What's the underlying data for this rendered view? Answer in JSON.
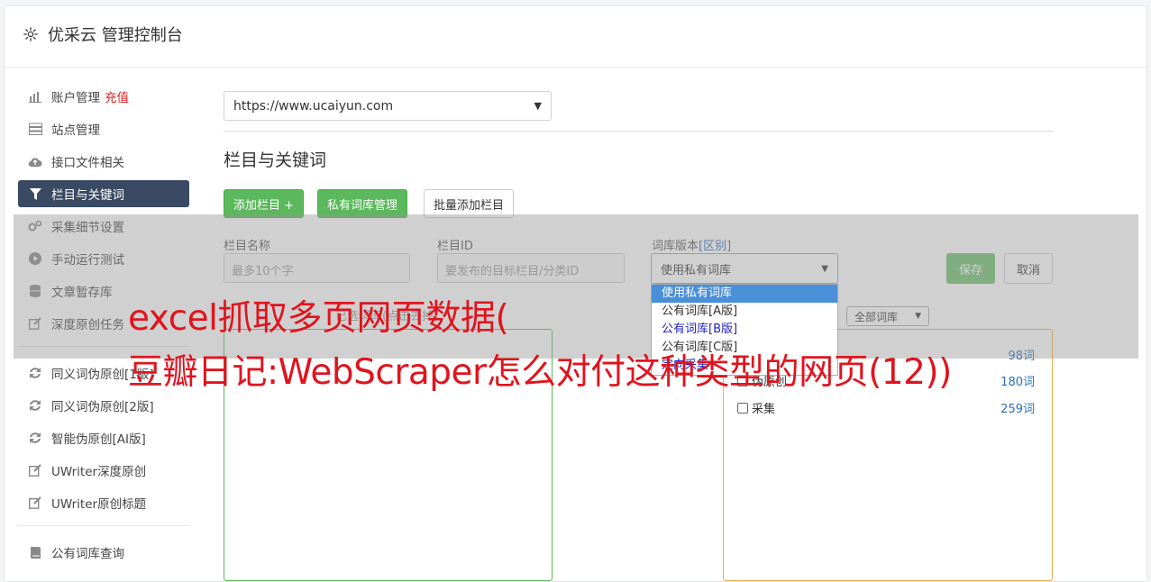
{
  "header": {
    "title": "优采云 管理控制台",
    "icon": "gear-icon"
  },
  "nav": {
    "items": [
      {
        "label": "账户管理",
        "icon": "bar-chart-icon",
        "extra": "充值"
      },
      {
        "label": "站点管理",
        "icon": "server-icon"
      },
      {
        "label": "接口文件相关",
        "icon": "cloud-upload-icon"
      },
      {
        "label": "栏目与关键词",
        "icon": "filter-icon",
        "active": true
      },
      {
        "label": "采集细节设置",
        "icon": "gears-icon"
      },
      {
        "label": "手动运行测试",
        "icon": "play-circle-icon"
      },
      {
        "label": "文章暂存库",
        "icon": "database-icon"
      },
      {
        "label": "深度原创任务",
        "icon": "edit-icon"
      }
    ],
    "items2": [
      {
        "label": "同义词伪原创[1版]",
        "icon": "refresh-icon"
      },
      {
        "label": "同义词伪原创[2版]",
        "icon": "refresh-icon"
      },
      {
        "label": "智能伪原创[AI版]",
        "icon": "refresh-icon"
      },
      {
        "label": "UWriter深度原创",
        "icon": "edit-icon"
      },
      {
        "label": "UWriter原创标题",
        "icon": "edit-icon"
      }
    ],
    "items3": [
      {
        "label": "公有词库查询",
        "icon": "book-icon"
      }
    ]
  },
  "main": {
    "site_select": "https://www.ucaiyun.com",
    "section_title": "栏目与关键词",
    "buttons": {
      "add_column": "添加栏目 +",
      "private_lib": "私有词库管理",
      "batch_add": "批量添加栏目"
    },
    "form": {
      "name_label": "栏目名称",
      "name_placeholder": "最多10个字",
      "id_label": "栏目ID",
      "id_placeholder": "要发布的目标栏目/分类ID",
      "lib_label": "词库版本",
      "lib_label_link": "[区别]",
      "lib_value": "使用私有词库",
      "save": "保存",
      "cancel": "取消"
    },
    "dropdown_options": [
      "使用私有词库",
      "公有词库[A版]",
      "公有词库[B版]",
      "公有词库[C版]",
      "定向采集"
    ],
    "left_box_header": "已选词库(点击去掉)",
    "lib_filter": "全部词库",
    "lib_rows": [
      {
        "label": "",
        "count": "98词"
      },
      {
        "label": "伪原创",
        "count": "180词"
      },
      {
        "label": "采集",
        "count": "259词"
      }
    ]
  },
  "watermark": {
    "line1": "excel抓取多页网页数据(",
    "line2": "豆瓣日记:WebScraper怎么对付这种类型的网页(12))"
  },
  "colors": {
    "accent_green": "#5cb85c",
    "active_nav": "#3b4a63",
    "watermark": "#e0141e",
    "select_blue": "#4a90d9"
  }
}
